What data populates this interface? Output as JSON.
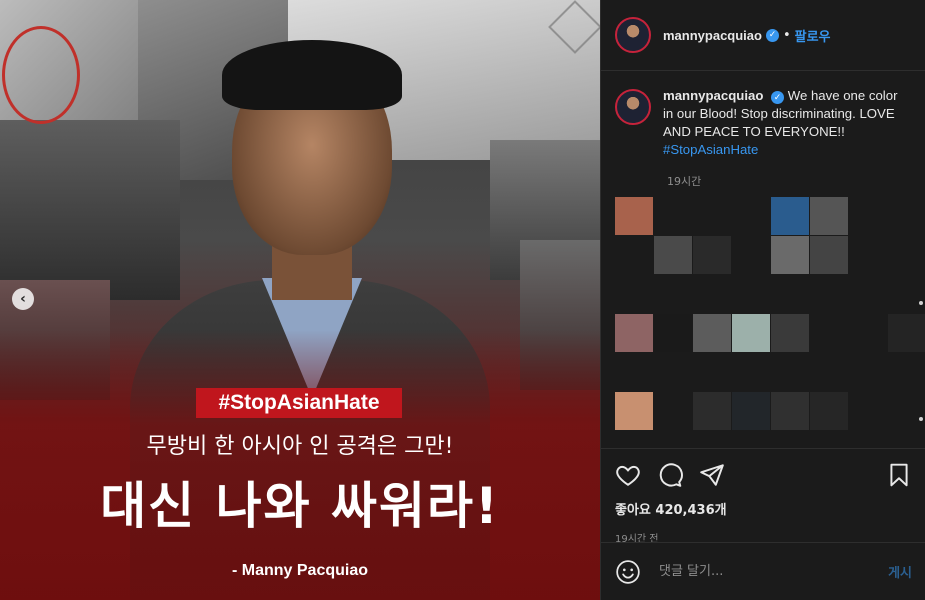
{
  "post": {
    "username": "mannypacquiao",
    "follow_label": "팔로우",
    "verified_label": "✓",
    "separator": "•"
  },
  "image": {
    "hashtag": "#StopAsianHate",
    "headline_small": "무방비 한 아시아 인 공격은 그만!",
    "headline_big": "대신 나와 싸워라!",
    "attribution": "- Manny Pacquiao",
    "carousel_prev": "‹"
  },
  "caption": {
    "username": "mannypacquiao",
    "text": "We have one color in our Blood! Stop discriminating. LOVE AND PEACE TO EVERYONE!!",
    "hashtag": "#StopAsianHate",
    "time": "19시간"
  },
  "actions": {
    "likes": "좋아요 420,436개",
    "post_time": "19시간 전"
  },
  "comment_box": {
    "placeholder": "댓글 달기...",
    "post_label": "게시"
  },
  "colors": {
    "accent": "#3897f0",
    "banner_red": "#c0161d",
    "pane_bg": "#1b1b1b"
  },
  "icons": [
    "heart-icon",
    "comment-icon",
    "share-icon",
    "bookmark-icon",
    "emoji-icon",
    "verified-icon",
    "chevron-left-icon"
  ]
}
